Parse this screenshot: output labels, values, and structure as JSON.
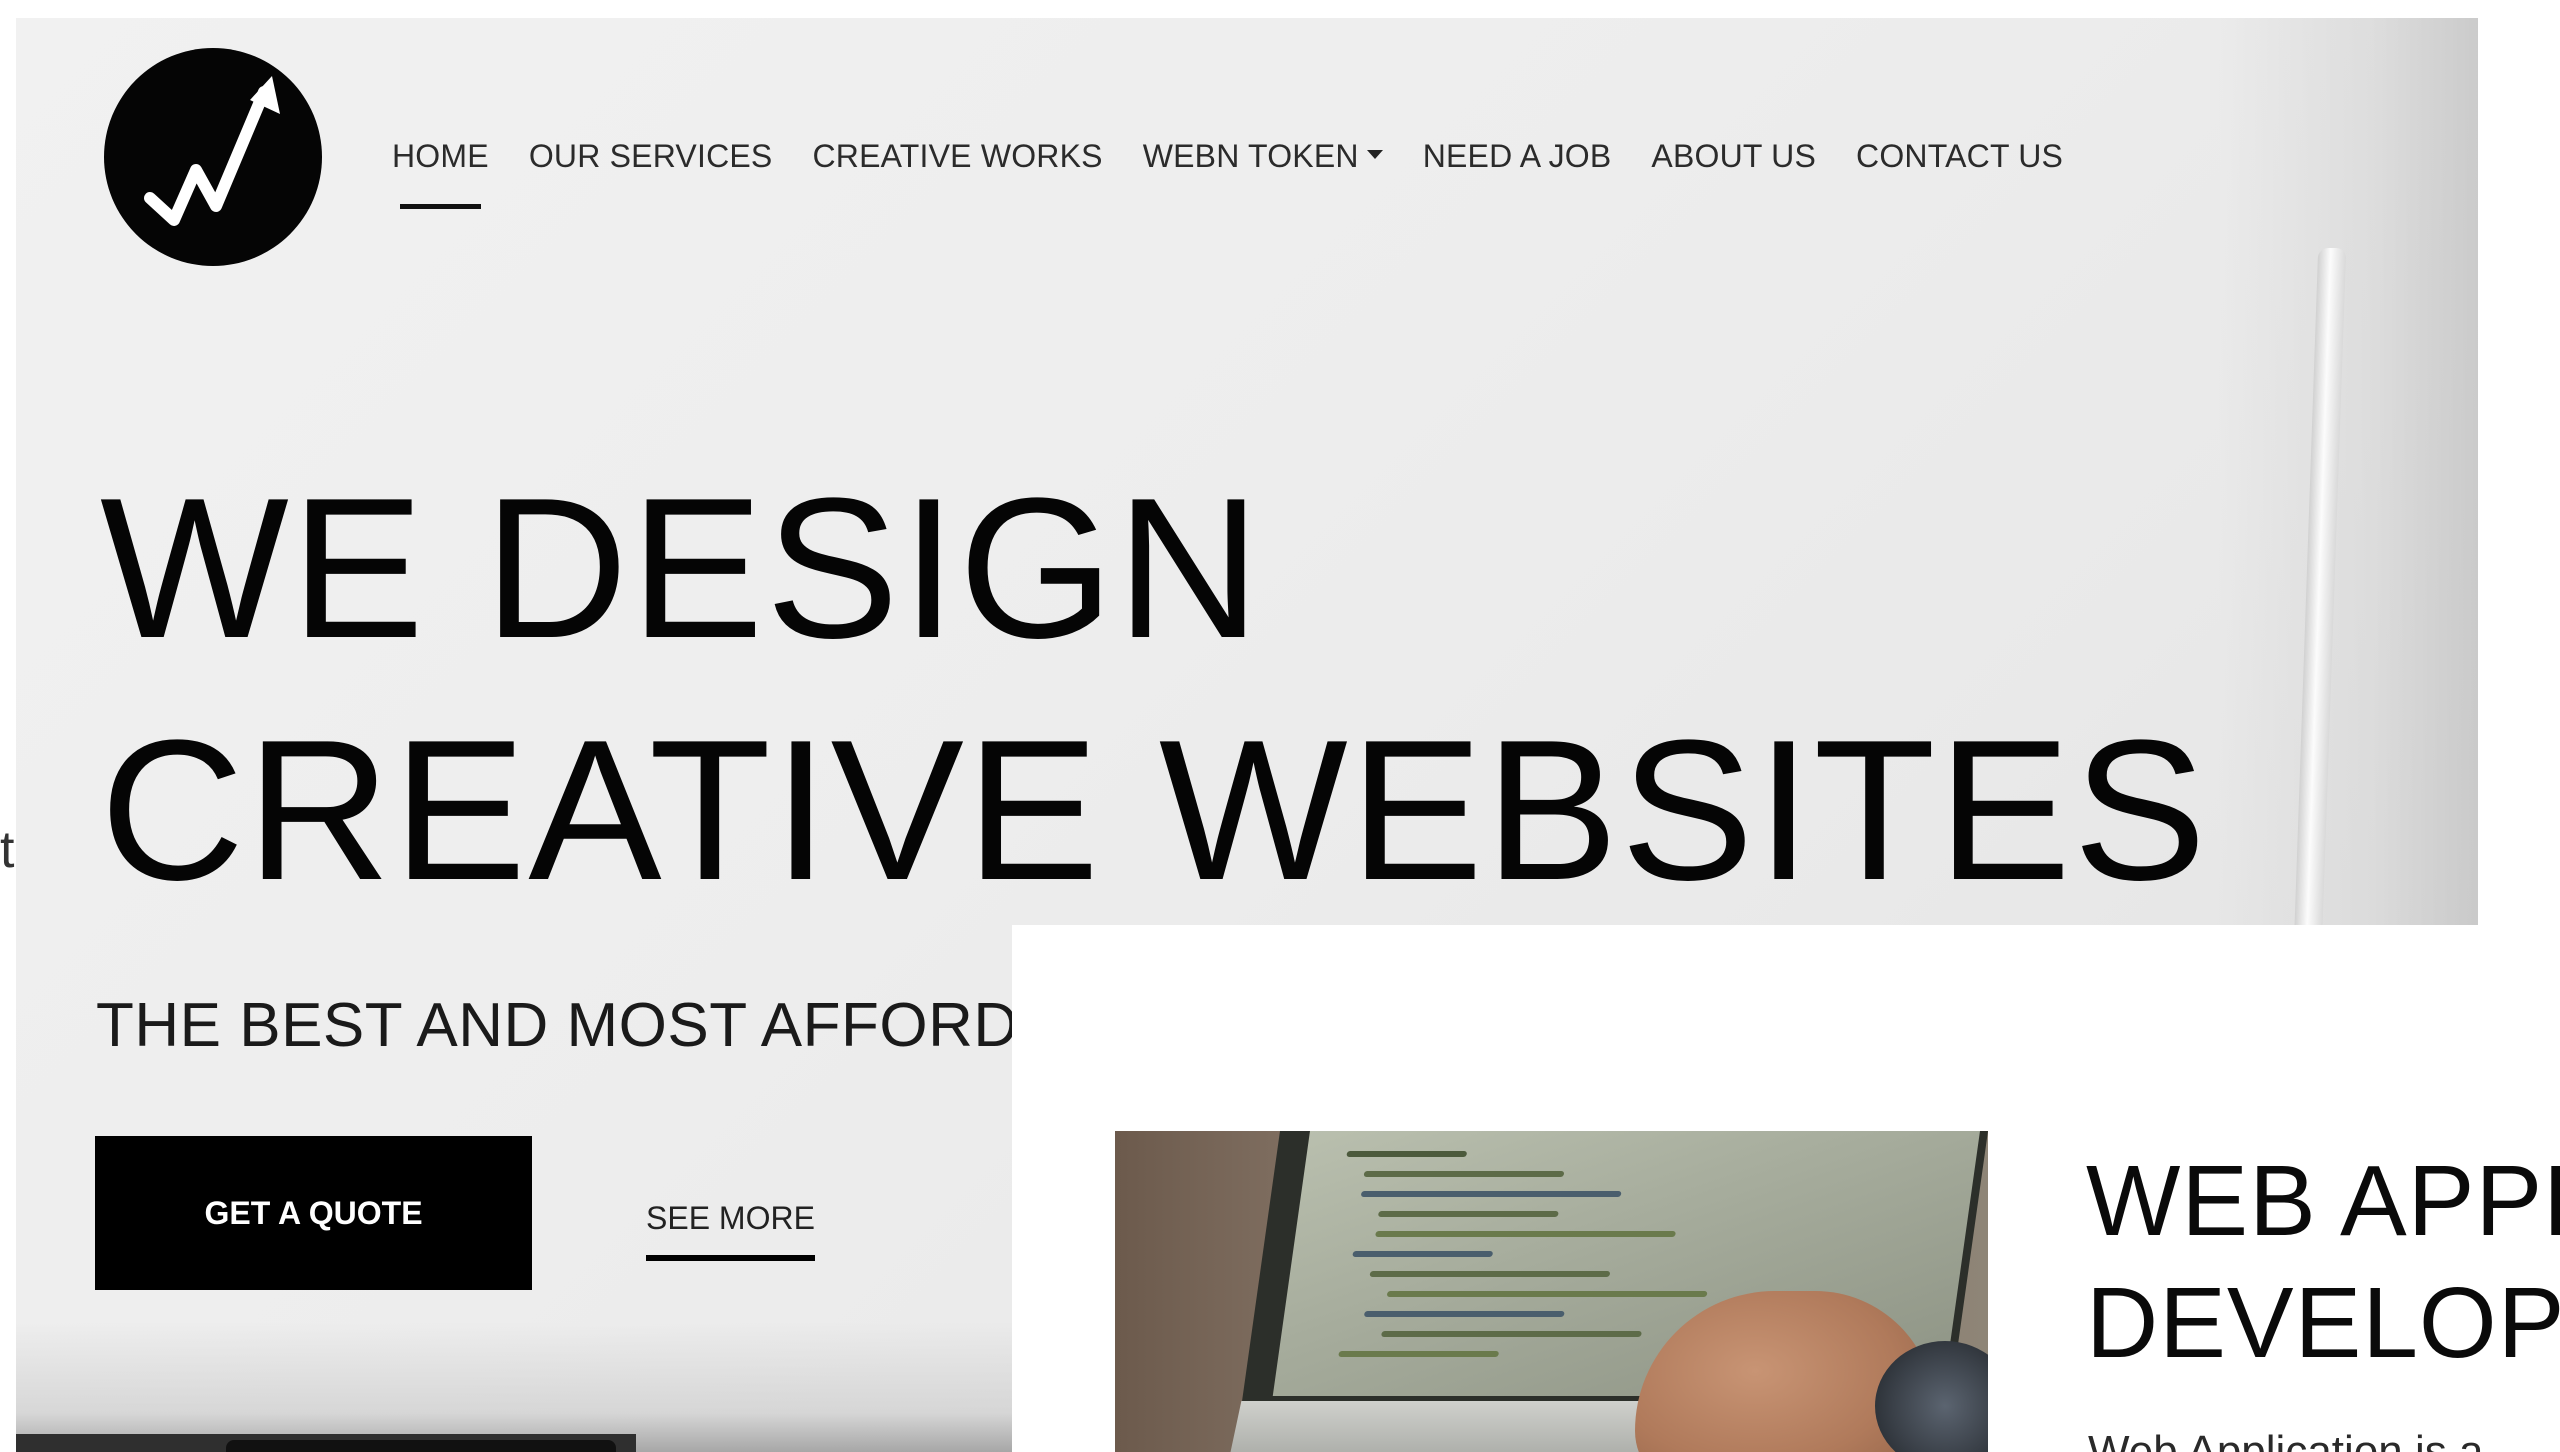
{
  "nav": {
    "items": [
      {
        "label": "HOME",
        "active": true
      },
      {
        "label": "OUR SERVICES",
        "active": false
      },
      {
        "label": "CREATIVE WORKS",
        "active": false
      },
      {
        "label": "WEBN TOKEN",
        "active": false,
        "dropdown": true
      },
      {
        "label": "NEED A JOB",
        "active": false
      },
      {
        "label": "ABOUT US",
        "active": false
      },
      {
        "label": "CONTACT US",
        "active": false
      }
    ]
  },
  "hero": {
    "headline_line1": "WE DESIGN",
    "headline_line2": "CREATIVE WEBSITES",
    "subline": "THE BEST AND MOST AFFORDA",
    "quote_button": "GET A QUOTE",
    "see_more": "SEE MORE"
  },
  "stray_text": "t",
  "service_card": {
    "title_line1": "WEB APPL",
    "title_line2": "DEVELOPN",
    "text": "Web Application is a"
  },
  "colors": {
    "hero_background": "#eeeeee",
    "button": "#000000",
    "text": "#050505"
  },
  "icons": {
    "logo": "growth-arrow-logo-icon",
    "dropdown": "caret-down-icon"
  }
}
